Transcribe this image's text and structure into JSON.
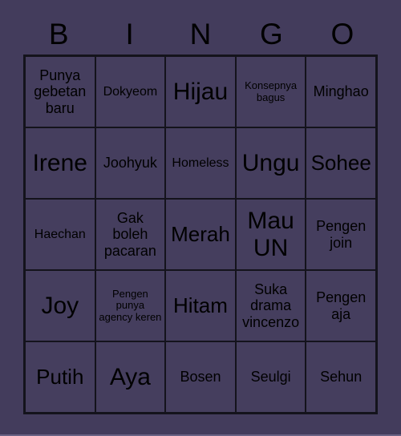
{
  "card": {
    "header_letters": [
      "B",
      "I",
      "N",
      "G",
      "O"
    ],
    "rows": [
      [
        {
          "text": "Punya gebetan baru",
          "size": "fs-md"
        },
        {
          "text": "Dokyeom",
          "size": "fs-sm"
        },
        {
          "text": "Hijau",
          "size": "fs-xxl"
        },
        {
          "text": "Konsepnya bagus",
          "size": "fs-xs"
        },
        {
          "text": "Minghao",
          "size": "fs-md"
        }
      ],
      [
        {
          "text": "Irene",
          "size": "fs-xxl"
        },
        {
          "text": "Joohyuk",
          "size": "fs-md"
        },
        {
          "text": "Homeless",
          "size": "fs-sm"
        },
        {
          "text": "Ungu",
          "size": "fs-xxl"
        },
        {
          "text": "Sohee",
          "size": "fs-xl"
        }
      ],
      [
        {
          "text": "Haechan",
          "size": "fs-sm"
        },
        {
          "text": "Gak boleh pacaran",
          "size": "fs-md"
        },
        {
          "text": "Merah",
          "size": "fs-xl"
        },
        {
          "text": "Mau UN",
          "size": "fs-xxl"
        },
        {
          "text": "Pengen join",
          "size": "fs-md"
        }
      ],
      [
        {
          "text": "Joy",
          "size": "fs-xxl"
        },
        {
          "text": "Pengen punya agency keren",
          "size": "fs-xs"
        },
        {
          "text": "Hitam",
          "size": "fs-xl"
        },
        {
          "text": "Suka drama vincenzo",
          "size": "fs-md"
        },
        {
          "text": "Pengen aja",
          "size": "fs-md"
        }
      ],
      [
        {
          "text": "Putih",
          "size": "fs-xl"
        },
        {
          "text": "Aya",
          "size": "fs-xxl"
        },
        {
          "text": "Bosen",
          "size": "fs-md"
        },
        {
          "text": "Seulgi",
          "size": "fs-md"
        },
        {
          "text": "Sehun",
          "size": "fs-md"
        }
      ]
    ]
  },
  "colors": {
    "background": "#433c5c",
    "cell_fill": "#453e5e",
    "grid_line": "#14131c",
    "text": "#000000",
    "bottom_edge": "#6a6385"
  }
}
